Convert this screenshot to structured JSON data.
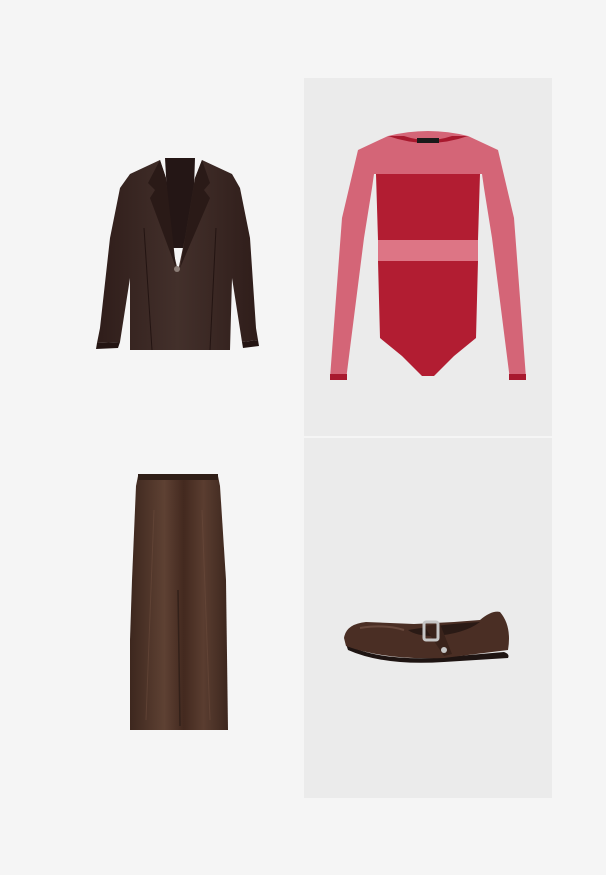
{
  "colors": {
    "page_background": "#f5f5f5",
    "tile_background": "#ebebeb",
    "blazer": "#3b2622",
    "bodysuit": "#b21d32",
    "bodysuit_mesh": "#d2566a",
    "skirt": "#4f3428",
    "flats": "#4a2e24"
  },
  "items": [
    {
      "name": "blazer",
      "icon": "blazer-icon"
    },
    {
      "name": "bodysuit",
      "icon": "bodysuit-icon"
    },
    {
      "name": "skirt",
      "icon": "skirt-icon"
    },
    {
      "name": "flats",
      "icon": "ballet-flat-icon"
    }
  ]
}
